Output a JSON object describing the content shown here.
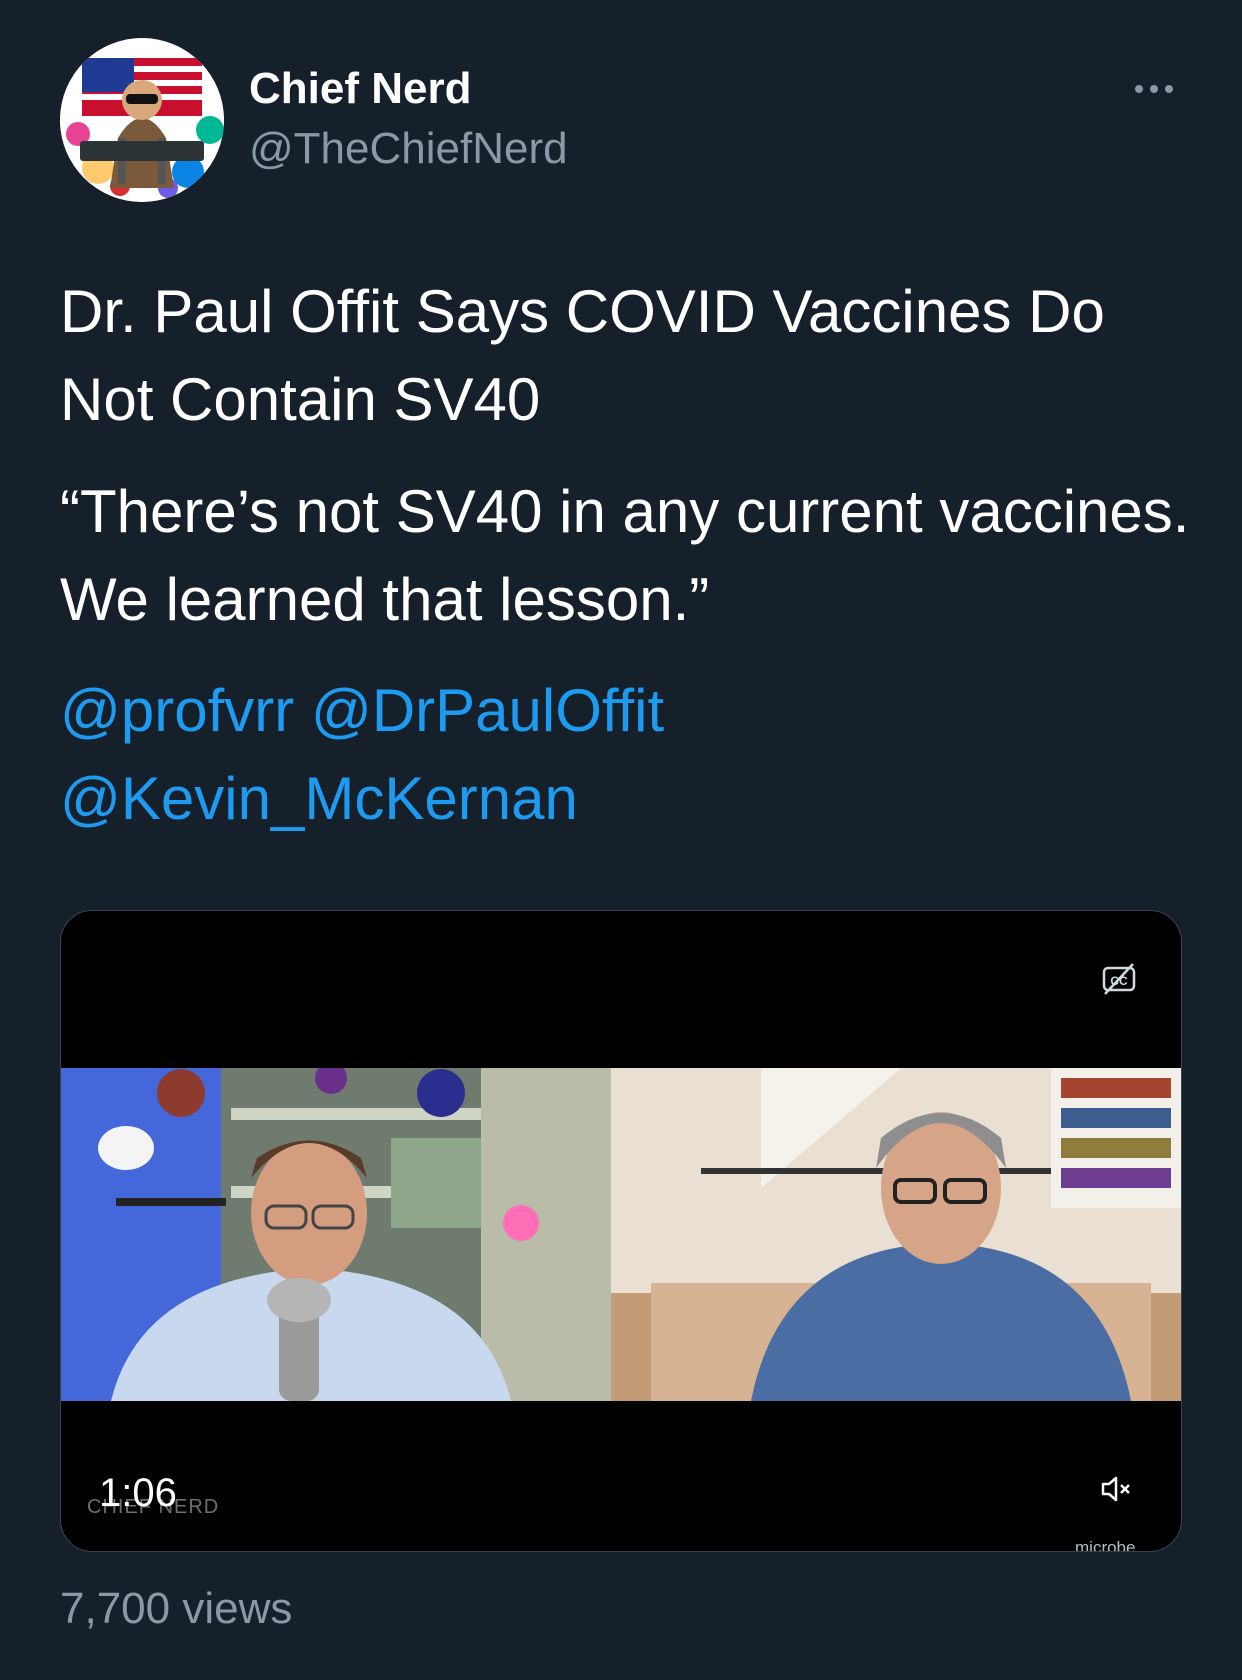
{
  "tweet": {
    "author": {
      "display_name": "Chief Nerd",
      "handle": "@TheChiefNerd",
      "avatar_badge": "CHIEF NERD"
    },
    "text_lines": [
      "Dr. Paul Offit Says COVID Vaccines Do Not Contain SV40",
      "“There’s not SV40 in any current vaccines. We learned that lesson.”"
    ],
    "mentions": [
      "@profvrr",
      "@DrPaulOffit",
      "@Kevin_McKernan"
    ],
    "video": {
      "duration": "1:06",
      "watermark": "CHIEF NERD",
      "brand": "microbe",
      "icons": [
        "closed-captions-icon",
        "mute-icon"
      ]
    },
    "views": "7,700 views"
  },
  "colors": {
    "background": "#15202b",
    "link": "#1d9bf0",
    "secondary_text": "#8b98a5",
    "border": "#38444d"
  }
}
